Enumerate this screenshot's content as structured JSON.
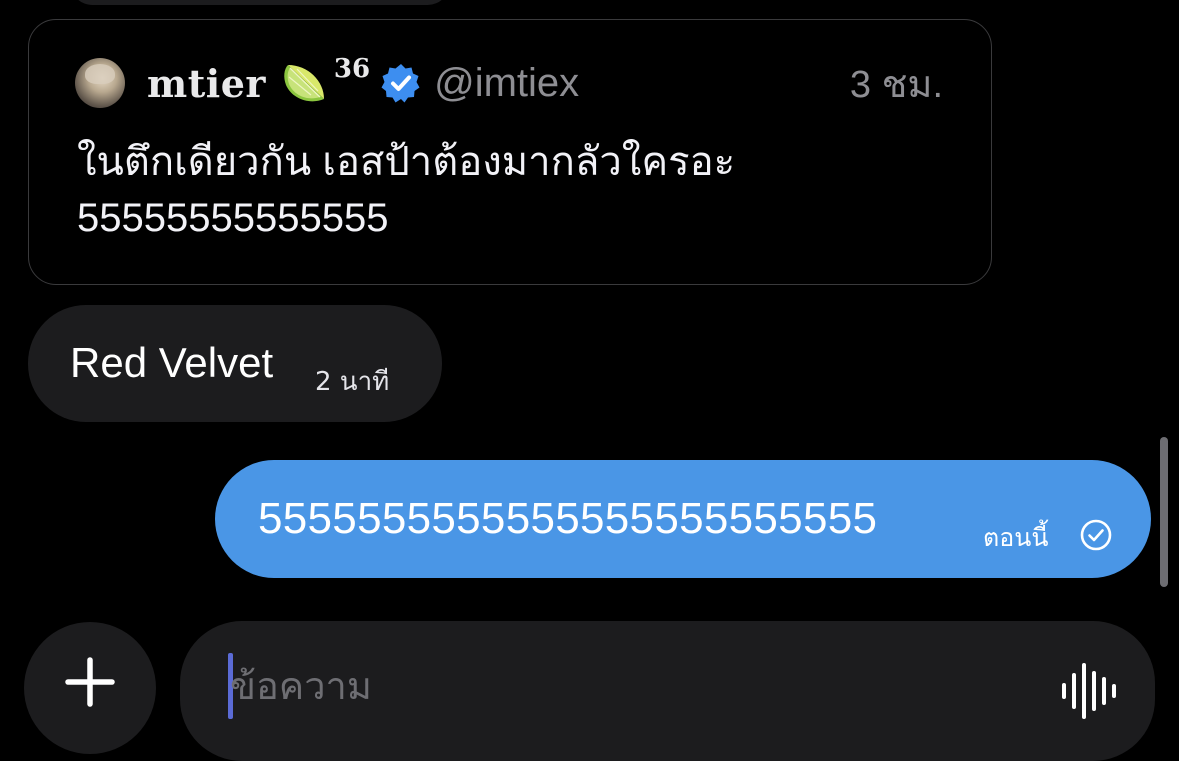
{
  "quoted_post": {
    "display_name": "mtier",
    "badge_icon": "lime-icon",
    "badge_count": "36",
    "verified_icon": "verified-badge-icon",
    "handle": "@imtiex",
    "time": "3 ชม.",
    "body_line1": "ในตึกเดียวกัน เอสป้าต้องมากลัวใครอะ",
    "body_line2": "55555555555555"
  },
  "messages": {
    "received": {
      "text": "Red Velvet",
      "time": "2 นาที"
    },
    "sent": {
      "text": "5555555555555555555555555",
      "time": "ตอนนี้",
      "status_icon": "sent-check-icon"
    }
  },
  "composer": {
    "add_icon": "plus-icon",
    "placeholder": "ข้อความ",
    "value": "",
    "voice_icon": "voice-waveform-icon"
  },
  "colors": {
    "background": "#000000",
    "bubble_received": "#1c1c1e",
    "bubble_sent": "#4a96e6",
    "verified": "#3d8ef0",
    "secondary_text": "#8e8e93",
    "caret": "#5b6bd6"
  }
}
